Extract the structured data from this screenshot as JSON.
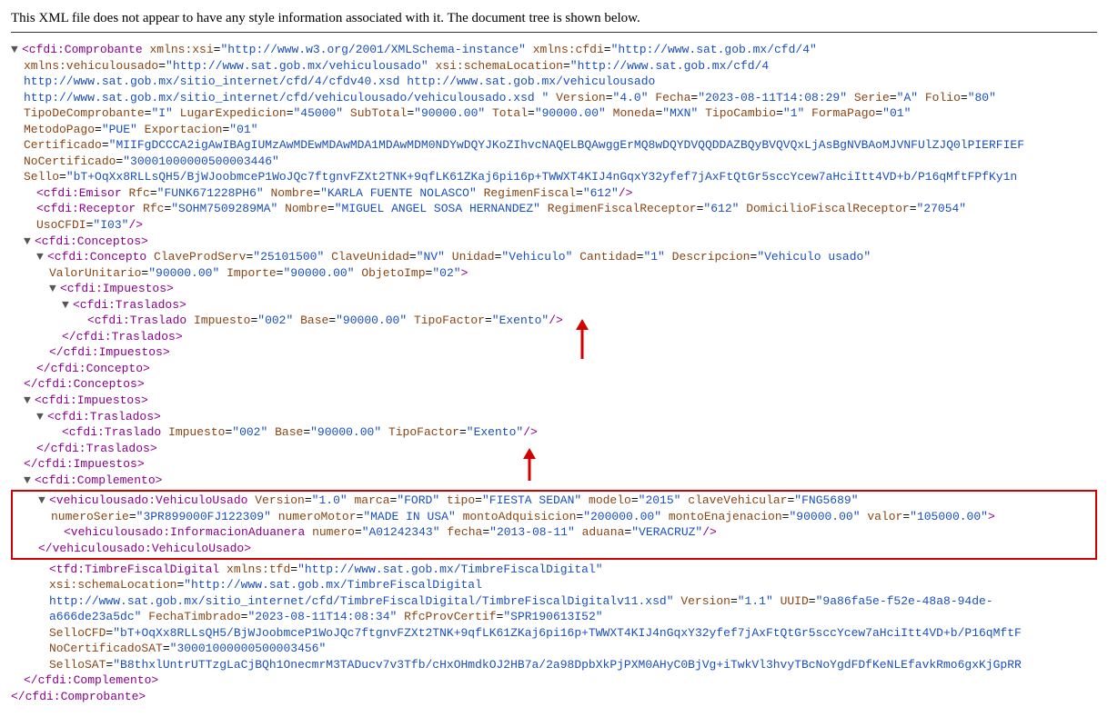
{
  "notice": "This XML file does not appear to have any style information associated with it. The document tree is shown below.",
  "xml": {
    "comprobante_open": "<cfdi:Comprobante",
    "ns_xsi": "xmlns:xsi=\"http://www.w3.org/2001/XMLSchema-instance\"",
    "ns_cfdi": "xmlns:cfdi=\"http://www.sat.gob.mx/cfd/4\"",
    "ns_veh": "xmlns:vehiculousado=\"http://www.sat.gob.mx/vehiculousado\"",
    "xsi_loc": "xsi:schemaLocation=\"http://www.sat.gob.mx/cfd/4",
    "loc_l1": "http://www.sat.gob.mx/sitio_internet/cfd/4/cfdv40.xsd http://www.sat.gob.mx/vehiculousado",
    "loc_l2": "http://www.sat.gob.mx/sitio_internet/cfd/vehiculousado/vehiculousado.xsd \"",
    "version": "Version=\"4.0\"",
    "fecha": "Fecha=\"2023-08-11T14:08:29\"",
    "serie": "Serie=\"A\"",
    "folio": "Folio=\"80\"",
    "tipocomp": "TipoDeComprobante=\"I\"",
    "lugar": "LugarExpedicion=\"45000\"",
    "subtotal": "SubTotal=\"90000.00\"",
    "total": "Total=\"90000.00\"",
    "moneda": "Moneda=\"MXN\"",
    "tipocambio": "TipoCambio=\"1\"",
    "formapago": "FormaPago=\"01\"",
    "metodopago": "MetodoPago=\"PUE\"",
    "exportacion": "Exportacion=\"01\"",
    "certificado": "Certificado=\"MIIFgDCCCA2igAwIBAgIUMzAwMDEwMDAwMDA1MDAwMDM0NDYwDQYJKoZIhvcNAQELBQAwggErMQ8wDQYDVQQDDAZBQyBVQVQxLjAsBgNVBAoMJVNFUlZJQ0lPIERFIEF…",
    "nocert": "NoCertificado=\"30001000000500003446\"",
    "sello": "Sello=\"bT+OqXx8RLLsQH5/BjWJoobmceP1WoJQc7ftgnvFZXt2TNK+9qfLK61ZKaj6pi16p+TWWXT4KIJ4nGqxY32yfef7jAxFtQtGr5sccYcew7aHciItt4VD+b/P16qMftFPfKy1n…",
    "emisor": "<cfdi:Emisor Rfc=\"FUNK671228PH6\" Nombre=\"KARLA FUENTE NOLASCO\" RegimenFiscal=\"612\"/>",
    "receptor": "<cfdi:Receptor Rfc=\"SOHM7509289MA\" Nombre=\"MIGUEL ANGEL SOSA HERNANDEZ\" RegimenFiscalReceptor=\"612\" DomicilioFiscalReceptor=\"27054\"",
    "usocfdi": "UsoCFDI=\"I03\"/>",
    "conceptos_open": "<cfdi:Conceptos>",
    "concepto_open": "<cfdi:Concepto ClaveProdServ=\"25101500\" ClaveUnidad=\"NV\" Unidad=\"Vehiculo\" Cantidad=\"1\" Descripcion=\"Vehiculo usado\"",
    "concepto_l2": "ValorUnitario=\"90000.00\" Importe=\"90000.00\" ObjetoImp=\"02\">",
    "impuestos_open": "<cfdi:Impuestos>",
    "traslados_open": "<cfdi:Traslados>",
    "traslado": "<cfdi:Traslado Impuesto=\"002\" Base=\"90000.00\" TipoFactor=\"Exento\"/>",
    "traslados_close": "</cfdi:Traslados>",
    "impuestos_close": "</cfdi:Impuestos>",
    "concepto_close": "</cfdi:Concepto>",
    "conceptos_close": "</cfdi:Conceptos>",
    "complemento_open": "<cfdi:Complemento>",
    "vehiculo_open": "<vehiculousado:VehiculoUsado Version=\"1.0\" marca=\"FORD\" tipo=\"FIESTA SEDAN\" modelo=\"2015\" claveVehicular=\"FNG5689\"",
    "vehiculo_l2": "numeroSerie=\"3PR899000FJ122309\" numeroMotor=\"MADE IN USA\" montoAdquisicion=\"200000.00\" montoEnajenacion=\"90000.00\" valor=\"105000.00\">",
    "info_aduanera": "<vehiculousado:InformacionAduanera numero=\"A01242343\" fecha=\"2013-08-11\" aduana=\"VERACRUZ\"/>",
    "vehiculo_close": "</vehiculousado:VehiculoUsado>",
    "tfd_open": "<tfd:TimbreFiscalDigital xmlns:tfd=\"http://www.sat.gob.mx/TimbreFiscalDigital\"",
    "tfd_loc": "xsi:schemaLocation=\"http://www.sat.gob.mx/TimbreFiscalDigital",
    "tfd_loc2": "http://www.sat.gob.mx/sitio_internet/cfd/TimbreFiscalDigital/TimbreFiscalDigitalv11.xsd\" Version=\"1.1\" UUID=\"9a86fa5e-f52e-48a8-94de-",
    "tfd_l3": "a666de23a5dc\" FechaTimbrado=\"2023-08-11T14:08:34\" RfcProvCertif=\"SPR190613I52\"",
    "tfd_sellocfd": "SelloCFD=\"bT+OqXx8RLLsQH5/BjWJoobmceP1WoJQc7ftgnvFZXt2TNK+9qfLK61ZKaj6pi16p+TWWXT4KIJ4nGqxY32yfef7jAxFtQtGr5sccYcew7aHciItt4VD+b/P16qMftF…",
    "tfd_nocert": "NoCertificadoSAT=\"30001000000500003456\"",
    "tfd_sellosat": "SelloSAT=\"B8thxlUntrUTTzgLaCjBQh1OnecmrM3TADucv7v3Tfb/cHxOHmdkOJ2HB7a/2a98DpbXkPjPXM0AHyC0BjVg+iTwkVl3hvyTBcNoYgdFDfKeNLEfavkRmo6gxKjGpRR…",
    "complemento_close": "</cfdi:Complemento>",
    "comprobante_close": "</cfdi:Comprobante>"
  }
}
